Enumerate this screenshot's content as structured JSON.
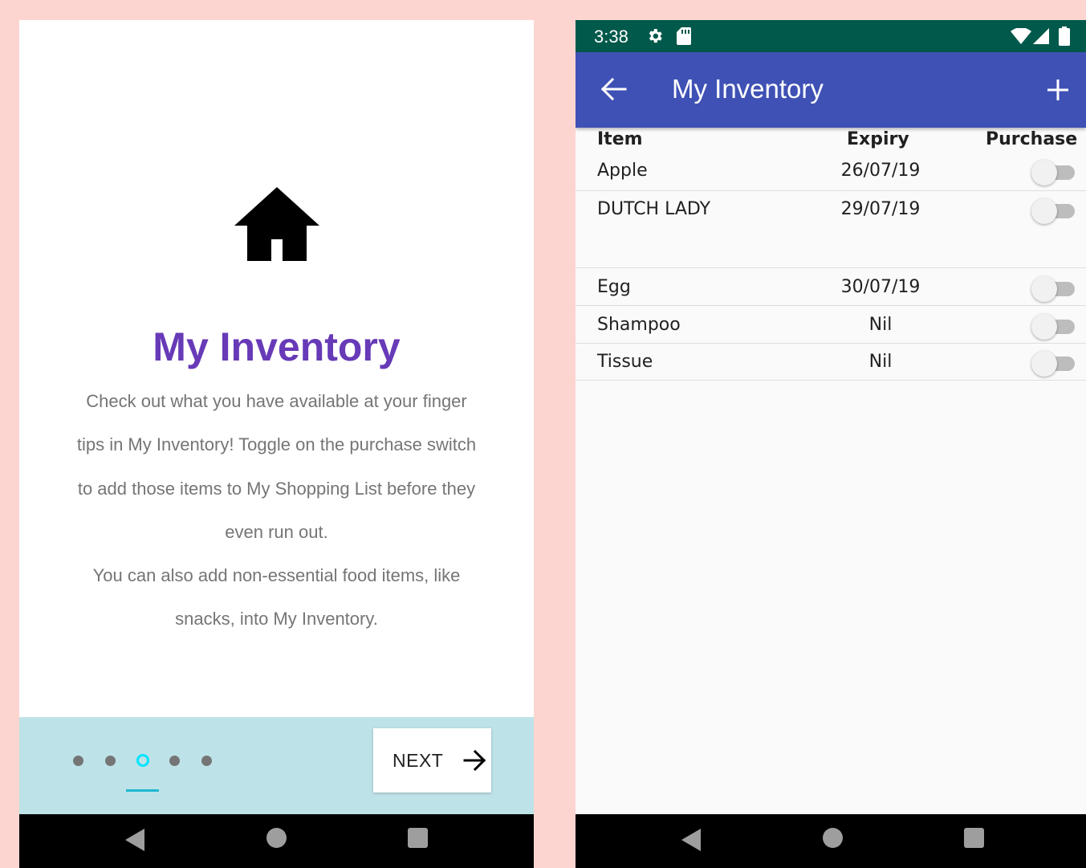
{
  "onboarding": {
    "title": "My Inventory",
    "description_lines": [
      "Check out what you have available at your finger",
      "tips in My Inventory! Toggle on the purchase switch",
      "to add those items to My Shopping List before they",
      "even run out.",
      "You can also add non-essential food items, like",
      "snacks, into My Inventory."
    ],
    "page_indicator": {
      "total": 5,
      "current": 3
    },
    "next_label": "NEXT",
    "icon": "home-icon"
  },
  "status_bar": {
    "time": "3:38",
    "icons": [
      "settings-icon",
      "sd-card-icon",
      "wifi-icon",
      "signal-icon",
      "battery-icon"
    ]
  },
  "app_bar": {
    "title": "My Inventory",
    "back_icon": "arrow-back-icon",
    "add_icon": "add-icon"
  },
  "table": {
    "headers": {
      "item": "Item",
      "expiry": "Expiry",
      "purchase": "Purchase"
    },
    "rows": [
      {
        "item": "Apple",
        "expiry": "26/07/19",
        "purchase": false
      },
      {
        "item": "DUTCH LADY",
        "expiry": "29/07/19",
        "purchase": false
      },
      {
        "item": "Egg",
        "expiry": "30/07/19",
        "purchase": false
      },
      {
        "item": "Shampoo",
        "expiry": "Nil",
        "purchase": false
      },
      {
        "item": "Tissue",
        "expiry": "Nil",
        "purchase": false
      }
    ]
  },
  "nav_bar": {
    "icons": [
      "back-triangle-icon",
      "home-circle-icon",
      "recents-square-icon"
    ]
  },
  "colors": {
    "primary": "#3f51b5",
    "status_bar": "#00594b",
    "title_purple": "#673ab7",
    "footer": "#bde3e8",
    "indicator_active": "#00e5ff",
    "background": "#fcd5d0"
  }
}
